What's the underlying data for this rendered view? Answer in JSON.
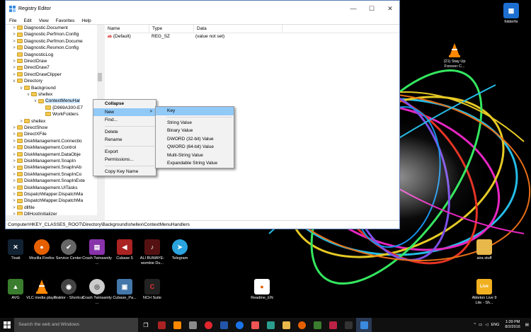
{
  "window": {
    "title": "Registry Editor",
    "menu": [
      "File",
      "Edit",
      "View",
      "Favorites",
      "Help"
    ],
    "minimize": "—",
    "maximize": "☐",
    "close": "✕"
  },
  "tree": {
    "rows": [
      {
        "label": "Diagnostic.Document",
        "indent": 1,
        "toggle": ">"
      },
      {
        "label": "Diagnostic.Perfmon.Config",
        "indent": 1,
        "toggle": ">"
      },
      {
        "label": "Diagnostic.Perfmon.Docume",
        "indent": 1,
        "toggle": ">"
      },
      {
        "label": "Diagnostic.Resmon.Config",
        "indent": 1,
        "toggle": ">"
      },
      {
        "label": "DiagnosticLog",
        "indent": 1,
        "toggle": ""
      },
      {
        "label": "DirectDraw",
        "indent": 1,
        "toggle": ">"
      },
      {
        "label": "DirectDraw7",
        "indent": 1,
        "toggle": ">"
      },
      {
        "label": "DirectDrawClipper",
        "indent": 1,
        "toggle": ">"
      },
      {
        "label": "Directory",
        "indent": 1,
        "toggle": "v"
      },
      {
        "label": "Background",
        "indent": 2,
        "toggle": "v"
      },
      {
        "label": "shellex",
        "indent": 3,
        "toggle": "v"
      },
      {
        "label": "ContextMenuHar",
        "indent": 4,
        "toggle": "v",
        "selected": true
      },
      {
        "label": "{D969A300-E7",
        "indent": 5,
        "toggle": ""
      },
      {
        "label": "WorkFolders",
        "indent": 5,
        "toggle": ""
      },
      {
        "label": "shellex",
        "indent": 2,
        "toggle": ">"
      },
      {
        "label": "DirectShow",
        "indent": 1,
        "toggle": ">"
      },
      {
        "label": "DirectXFile",
        "indent": 1,
        "toggle": ">"
      },
      {
        "label": "DiskManagement.Connectio",
        "indent": 1,
        "toggle": ">"
      },
      {
        "label": "DiskManagement.Control",
        "indent": 1,
        "toggle": ">"
      },
      {
        "label": "DiskManagement.DataObje",
        "indent": 1,
        "toggle": ">"
      },
      {
        "label": "DiskManagement.SnapIn",
        "indent": 1,
        "toggle": ">"
      },
      {
        "label": "DiskManagement.SnapInAb",
        "indent": 1,
        "toggle": ">"
      },
      {
        "label": "DiskManagement.SnapInCo",
        "indent": 1,
        "toggle": ">"
      },
      {
        "label": "DiskManagement.SnapInExte",
        "indent": 1,
        "toggle": ">"
      },
      {
        "label": "DiskManagement.UITasks",
        "indent": 1,
        "toggle": ">"
      },
      {
        "label": "DispatchMapper.DispatchMa",
        "indent": 1,
        "toggle": ">"
      },
      {
        "label": "DispatchMapper.DispatchMa",
        "indent": 1,
        "toggle": ">"
      },
      {
        "label": "dllfile",
        "indent": 1,
        "toggle": ">"
      },
      {
        "label": "DllHostInitializer",
        "indent": 1,
        "toggle": ">"
      }
    ]
  },
  "values": {
    "headers": [
      "Name",
      "Type",
      "Data"
    ],
    "rows": [
      {
        "name": "(Default)",
        "type": "REG_SZ",
        "data": "(value not set)",
        "icon": "ab"
      }
    ]
  },
  "statusbar": "Computer\\HKEY_CLASSES_ROOT\\Directory\\Background\\shellex\\ContextMenuHandlers",
  "context_menu": {
    "items": [
      "Collapse",
      "New",
      "Find...",
      "Delete",
      "Rename",
      "Export",
      "Permissions...",
      "Copy Key Name"
    ],
    "new_arrow": ">"
  },
  "submenu": {
    "items": [
      "Key",
      "String Value",
      "Binary Value",
      "DWORD (32-bit) Value",
      "QWORD (64-bit) Value",
      "Multi-String Value",
      "Expandable String Value"
    ]
  },
  "desktop": {
    "icons": [
      {
        "label": "folderfix",
        "color": "#1c6fd1"
      },
      {
        "label": "(21) Stay Up Forever C...",
        "color": "#ff8800"
      },
      {
        "label": "Tixati",
        "color": "#2255aa"
      },
      {
        "label": "Mozilla Firefox",
        "color": "#e66000"
      },
      {
        "label": "Service Center",
        "color": "#555555"
      },
      {
        "label": "Crash Twinsanity ...",
        "color": "#8833aa"
      },
      {
        "label": "Cubase 5",
        "color": "#aa2222"
      },
      {
        "label": "ALI BUMAYE-wombie Du...",
        "color": "#551111"
      },
      {
        "label": "Telegram",
        "color": "#2aa3df"
      },
      {
        "label": "aira stuff",
        "color": "#e8b84a"
      },
      {
        "label": "AVG",
        "color": "#3a7d2e"
      },
      {
        "label": "VLC media player",
        "color": "#ff8800"
      },
      {
        "label": "Traktor - Shortcut",
        "color": "#444444"
      },
      {
        "label": "Crash Twinsanity ...",
        "color": "#999999"
      },
      {
        "label": "Cubase_Pa...",
        "color": "#4477aa"
      },
      {
        "label": "NCH Suite",
        "color": "#cc2222"
      },
      {
        "label": "Readme_EN",
        "color": "#e66000"
      },
      {
        "label": "Ableton Live 9 Lite - Sh...",
        "color": "#f0b020"
      }
    ]
  },
  "taskbar": {
    "search_placeholder": "Search the web and Windows",
    "tray_lang": "ENG",
    "time": "1:39 PM",
    "date": "8/2/2016"
  }
}
